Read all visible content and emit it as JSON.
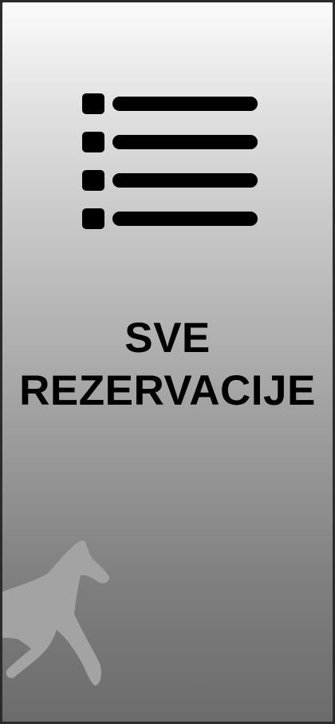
{
  "tile": {
    "icon": "list-icon",
    "title_line1": "SVE",
    "title_line2": "REZERVACIJE",
    "watermark_icon": "horse-icon",
    "colors": {
      "gradient_top": "#fbfbfb",
      "gradient_bottom": "#6c6c6c",
      "text": "#000000",
      "watermark": "#a3a3a3",
      "border": "#2b2b2b"
    }
  }
}
